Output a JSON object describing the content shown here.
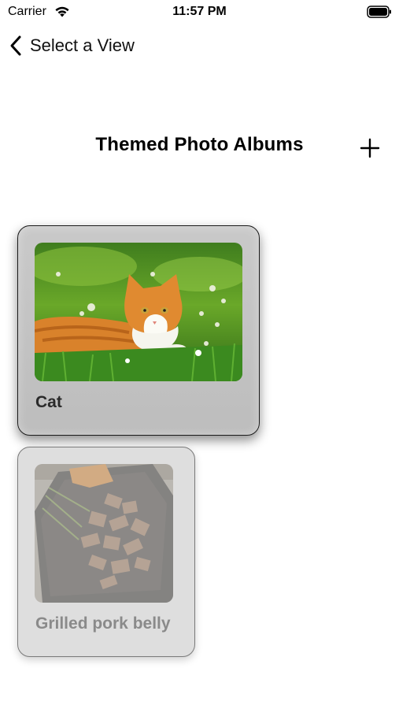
{
  "status_bar": {
    "carrier": "Carrier",
    "time": "11:57 PM",
    "wifi_icon": "wifi-icon",
    "battery_icon": "battery-icon"
  },
  "nav": {
    "back_label": "Select a View",
    "back_icon": "chevron-left-icon"
  },
  "header": {
    "title": "Themed Photo Albums",
    "add_icon": "plus-icon"
  },
  "albums": [
    {
      "label": "Cat",
      "image": "orange tabby cat lying in grass photo",
      "state": "selected"
    },
    {
      "label": "Grilled pork belly",
      "image": "grilled pork belly on tray photo",
      "state": "dimmed"
    }
  ],
  "colors": {
    "card_background": "#c4c4c4",
    "card_border": "#1a1a1a",
    "text": "#000000"
  }
}
